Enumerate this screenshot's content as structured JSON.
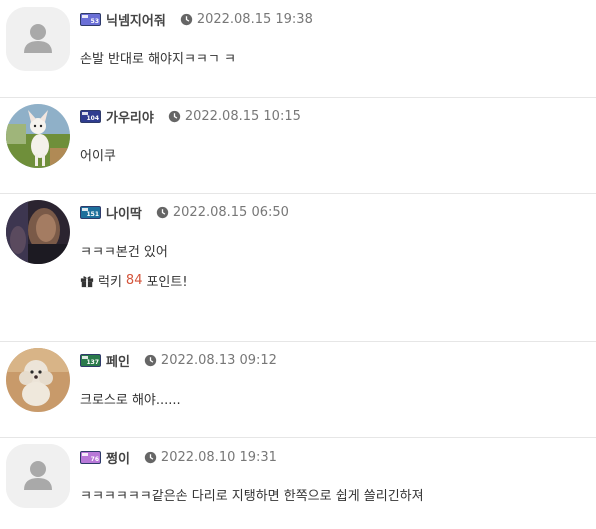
{
  "comments": [
    {
      "nickname": "닉넴지어줘",
      "level": "53",
      "level_color": "#6a6fd6",
      "date": "2022.08.15 19:38",
      "text": "손발 반대로 해야지ㅋㅋㄱ ㅋ",
      "avatar": "default-avatar-icon"
    },
    {
      "nickname": "가우리야",
      "level": "104",
      "level_color": "#2f3c8f",
      "date": "2022.08.15 10:15",
      "text": "어이쿠",
      "avatar": "chihuahua-photo"
    },
    {
      "nickname": "나이딱",
      "level": "151",
      "level_color": "#1d6f9c",
      "date": "2022.08.15 06:50",
      "text": "ㅋㅋㅋ본건 있어",
      "lucky_prefix": "럭키",
      "lucky_points": "84",
      "lucky_suffix": "포인트!",
      "avatar": "portrait-photo"
    },
    {
      "nickname": "페인",
      "level": "137",
      "level_color": "#2a7a4b",
      "date": "2022.08.13 09:12",
      "text": "크로스로 해야......",
      "avatar": "poodle-photo"
    },
    {
      "nickname": "쩡이",
      "level": "76",
      "level_color": "#b878d8",
      "date": "2022.08.10 19:31",
      "text": "ㅋㅋㅋㅋㅋㅋ같은손 다리로 지탱하면 한쪽으로 쉽게 쓸리긴하져",
      "avatar": "default-avatar-icon"
    }
  ]
}
